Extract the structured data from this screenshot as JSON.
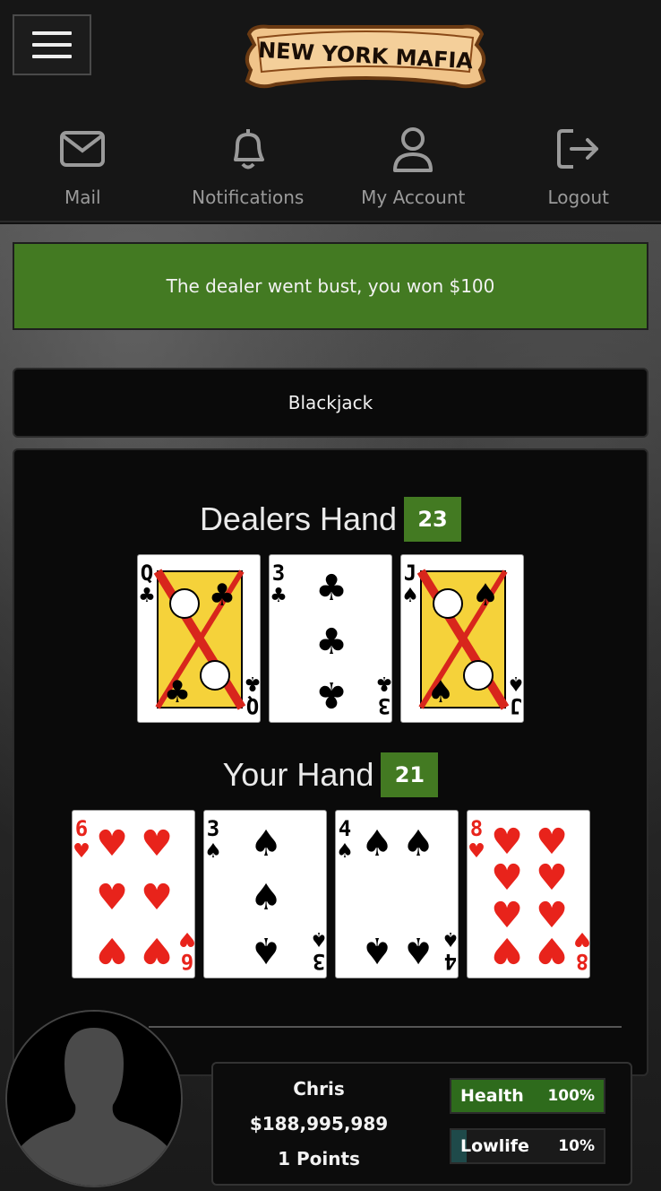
{
  "header": {
    "logo_text": "NEW YORK MAFIA",
    "nav": [
      {
        "label": "Mail",
        "icon": "mail-icon"
      },
      {
        "label": "Notifications",
        "icon": "bell-icon"
      },
      {
        "label": "My Account",
        "icon": "user-icon"
      },
      {
        "label": "Logout",
        "icon": "logout-icon"
      }
    ]
  },
  "alert": {
    "message": "The dealer went bust, you won $100",
    "color": "#437a22"
  },
  "game": {
    "title": "Blackjack",
    "dealer": {
      "label": "Dealers Hand",
      "score": "23",
      "cards": [
        {
          "rank": "Q",
          "suit": "clubs"
        },
        {
          "rank": "3",
          "suit": "clubs"
        },
        {
          "rank": "J",
          "suit": "spades"
        }
      ]
    },
    "player": {
      "label": "Your Hand",
      "score": "21",
      "cards": [
        {
          "rank": "6",
          "suit": "hearts"
        },
        {
          "rank": "3",
          "suit": "spades"
        },
        {
          "rank": "4",
          "suit": "spades"
        },
        {
          "rank": "8",
          "suit": "hearts"
        }
      ]
    }
  },
  "player_status": {
    "name": "Chris",
    "money": "$188,995,989",
    "points": "1 Points",
    "health": {
      "label": "Health",
      "value": "100%",
      "fraction": 1.0,
      "color": "#2e6b1c"
    },
    "lowlife": {
      "label": "Lowlife",
      "value": "10%",
      "fraction": 0.1,
      "color": "#1f4a4a"
    }
  }
}
